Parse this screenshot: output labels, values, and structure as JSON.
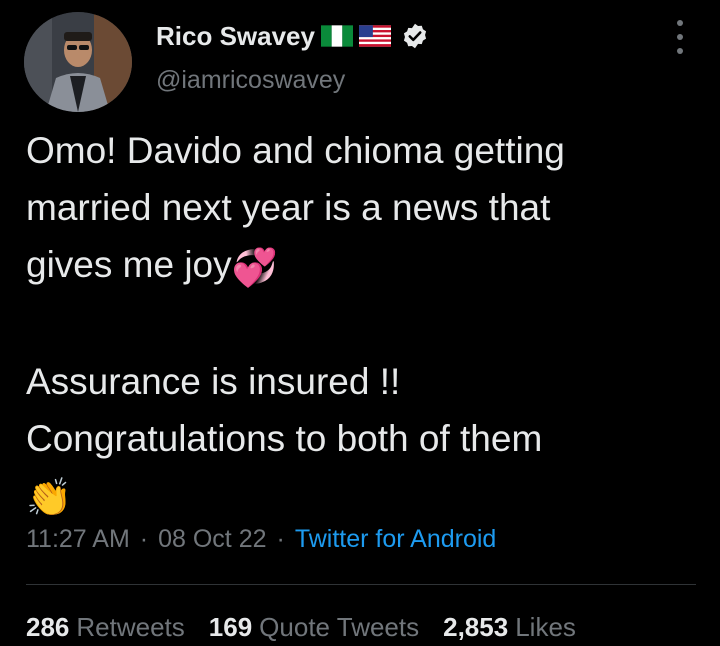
{
  "user": {
    "display_name": "Rico Swavey",
    "flags": [
      "nigeria-flag-icon",
      "usa-flag-icon"
    ],
    "verified": true,
    "handle": "@iamricoswavey"
  },
  "tweet": {
    "lines": [
      "Omo! Davido and chioma getting",
      "married next year is a news that",
      "gives me joy"
    ],
    "emoji_1": "💞",
    "lines_2": [
      "Assurance is insured !!",
      "Congratulations to both of them"
    ],
    "emoji_2": "👏"
  },
  "meta": {
    "time": "11:27 AM",
    "sep1": "·",
    "date": "08 Oct 22",
    "sep2": "·",
    "source": "Twitter for Android"
  },
  "stats": {
    "retweets_count": "286",
    "retweets_label": "Retweets",
    "quotes_count": "169",
    "quotes_label": "Quote Tweets",
    "likes_count": "2,853",
    "likes_label": "Likes"
  },
  "colors": {
    "background": "#000000",
    "text": "#e7e9ea",
    "muted": "#71767b",
    "link": "#1d9bf0",
    "verified": "#e7e9ea"
  }
}
